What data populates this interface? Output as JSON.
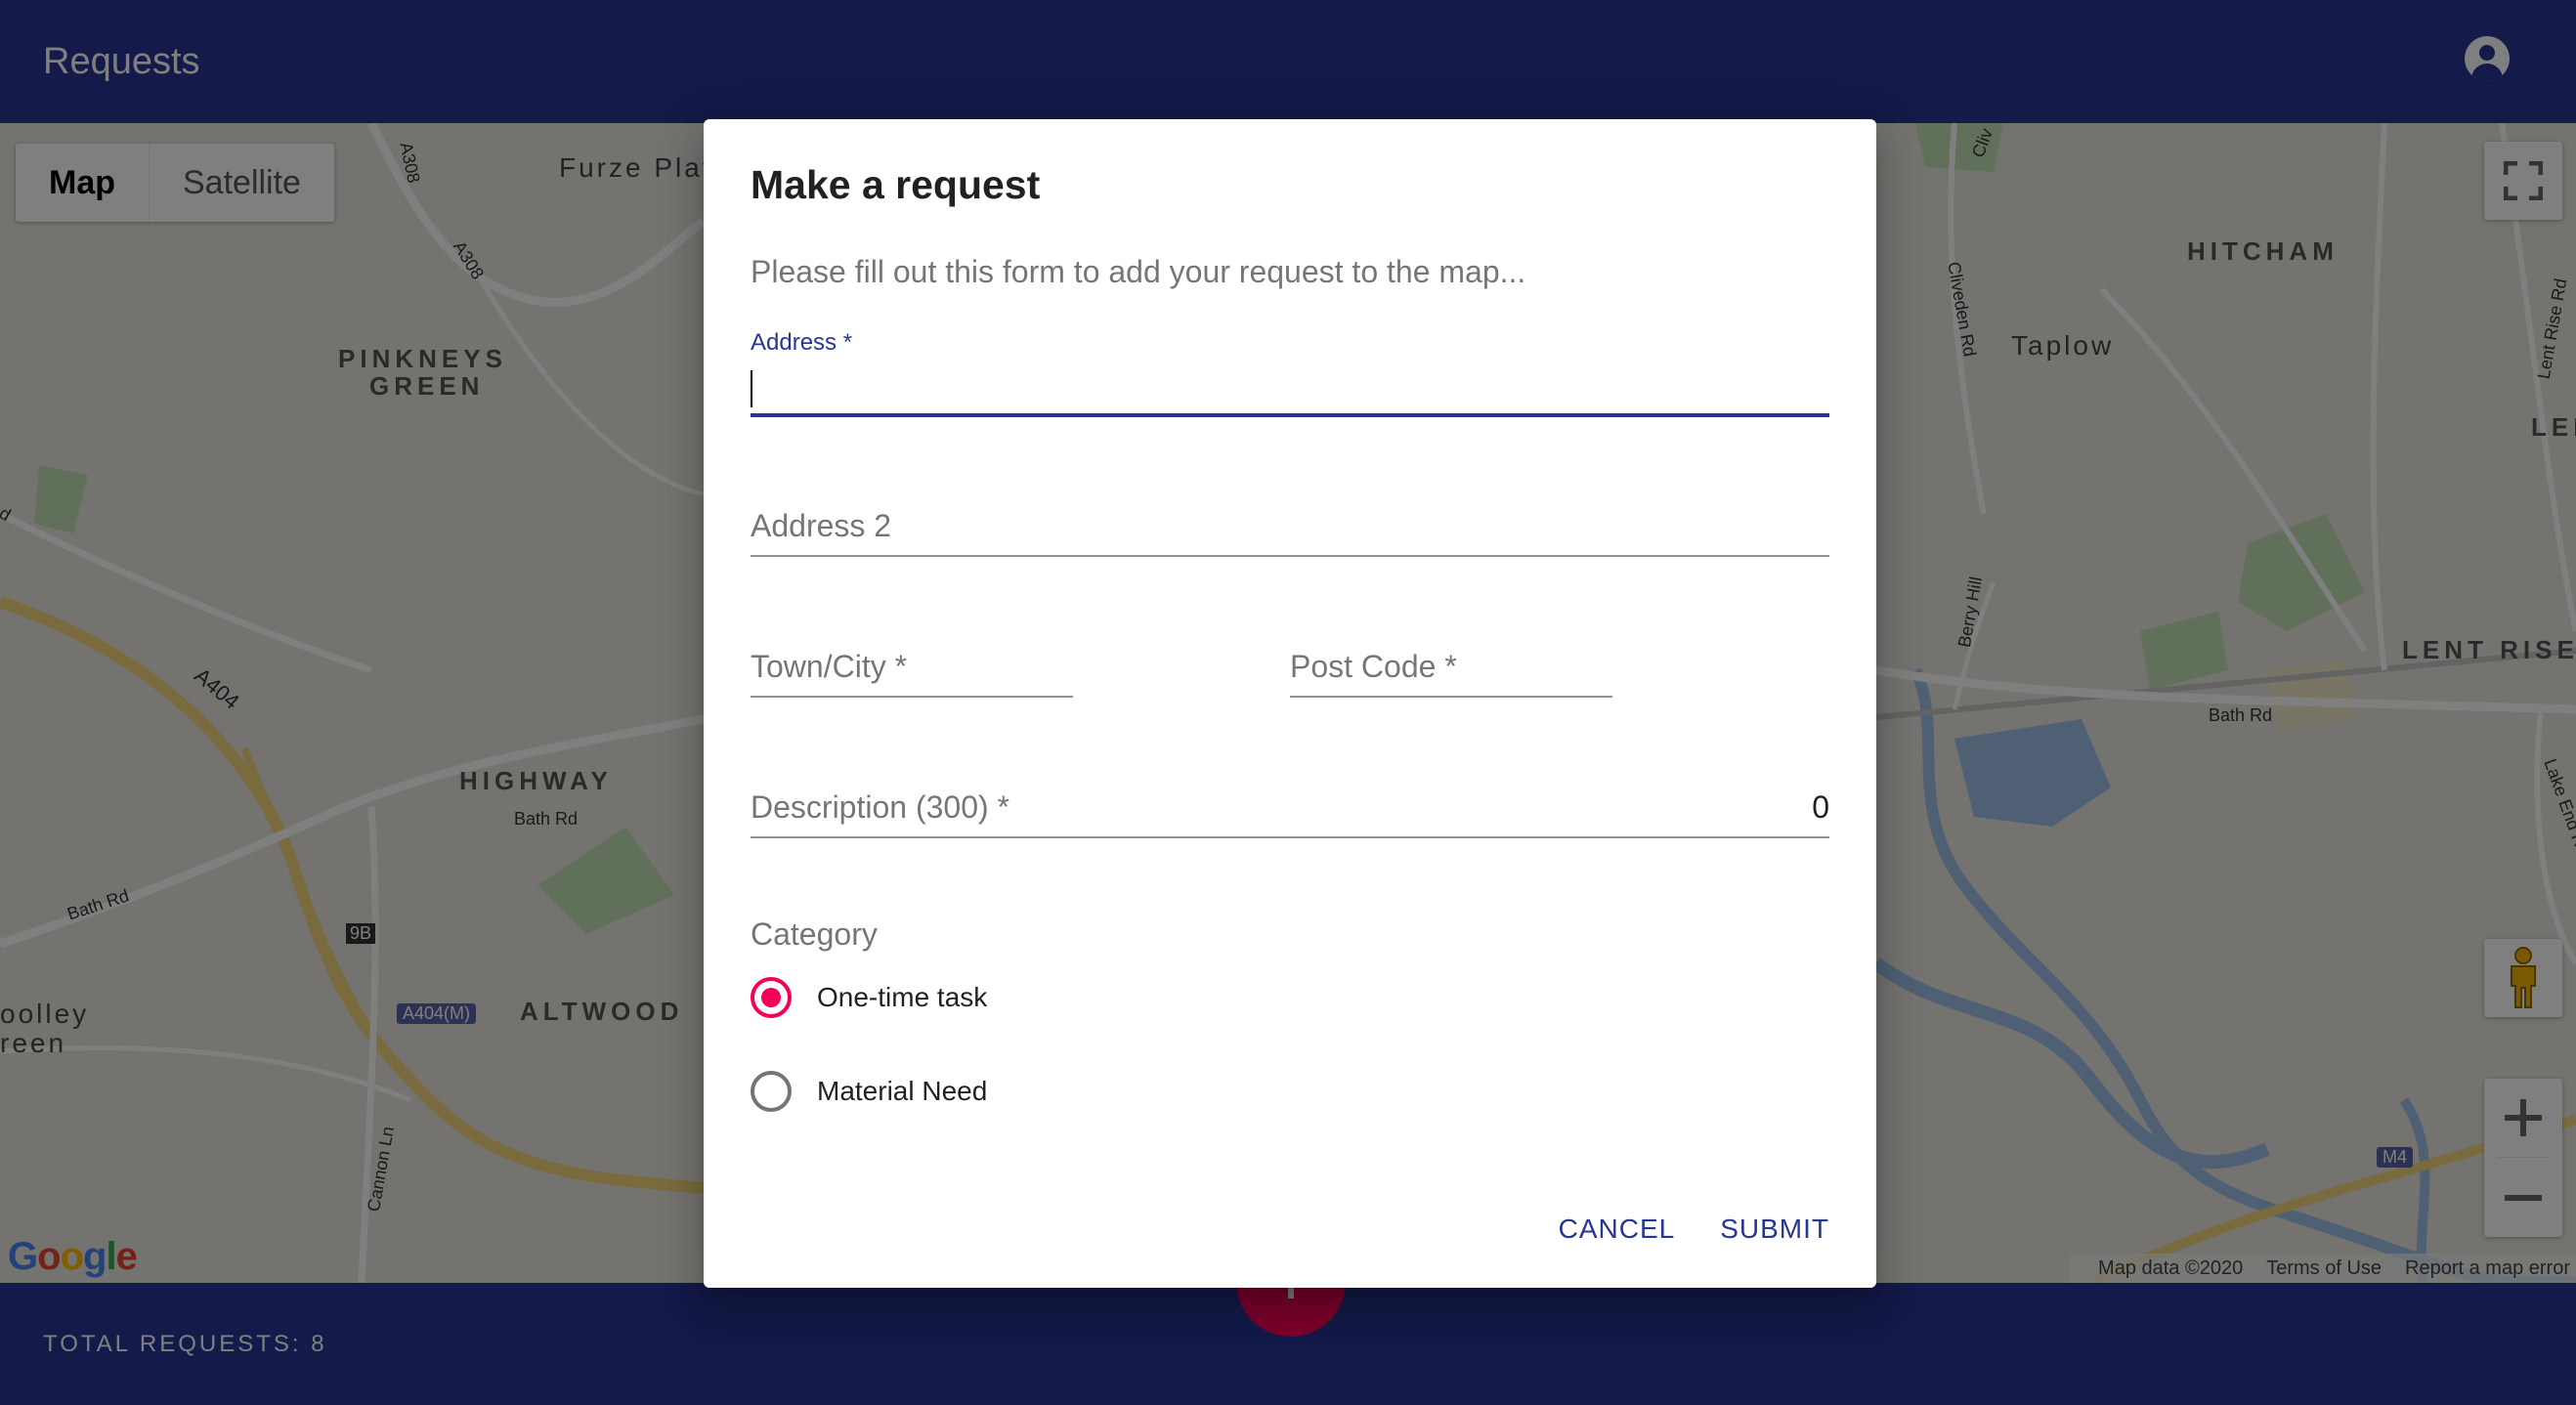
{
  "app": {
    "title": "Requests",
    "total_requests_label": "TOTAL REQUESTS: 8"
  },
  "icons": {
    "account": "account-circle-icon",
    "fullscreen": "fullscreen-icon",
    "pegman": "pegman-icon",
    "zoom_in": "plus-icon",
    "zoom_out": "minus-icon",
    "fab": "plus-icon"
  },
  "colors": {
    "primary": "#283593",
    "accent": "#f50057"
  },
  "map": {
    "map_type_options": [
      "Map",
      "Satellite"
    ],
    "selected_map_type": "Map",
    "logo": "Google",
    "attribution": [
      "Map data ©2020",
      "Terms of Use",
      "Report a map error"
    ],
    "labels": {
      "furze_platt": "Furze Platt S",
      "pinkneys_1": "PINKNEYS",
      "pinkneys_2": "GREEN",
      "highway": "HIGHWAY",
      "bath_rd_1": "Bath Rd",
      "bath_rd_2": "Bath Rd",
      "bath_rd_3": "Bath Rd",
      "altwood": "ALTWOOD",
      "a404m": "A404(M)",
      "a404": "A404",
      "nine_b": "9B",
      "a308_1": "A308",
      "a308_2": "A308",
      "cannon_ln": "Cannon Ln",
      "cox_1": "oolley",
      "cox_2": "reen",
      "hitcham": "HITCHAM",
      "taplow": "Taplow",
      "lent_rise": "LENT RISE",
      "len": "LEN",
      "cliveden_rd": "Cliveden Rd",
      "berry_hill": "Berry Hill",
      "lent_rise_rd": "Lent Rise Rd",
      "lake_end_rd": "Lake End Rd",
      "m4": "M4",
      "cliv": "Cliv",
      "d_label": "d"
    }
  },
  "dialog": {
    "title": "Make a request",
    "description": "Please fill out this form to add your request to the map...",
    "fields": {
      "address": {
        "label": "Address *",
        "value": ""
      },
      "address2": {
        "label": "Address 2",
        "value": ""
      },
      "town": {
        "label": "Town/City *",
        "value": ""
      },
      "postcode": {
        "label": "Post Code *",
        "value": ""
      },
      "description": {
        "label": "Description (300) *",
        "value": "",
        "counter": "0"
      }
    },
    "category": {
      "label": "Category",
      "options": [
        "One-time task",
        "Material Need"
      ],
      "selected": "One-time task"
    },
    "actions": {
      "cancel": "CANCEL",
      "submit": "SUBMIT"
    }
  }
}
